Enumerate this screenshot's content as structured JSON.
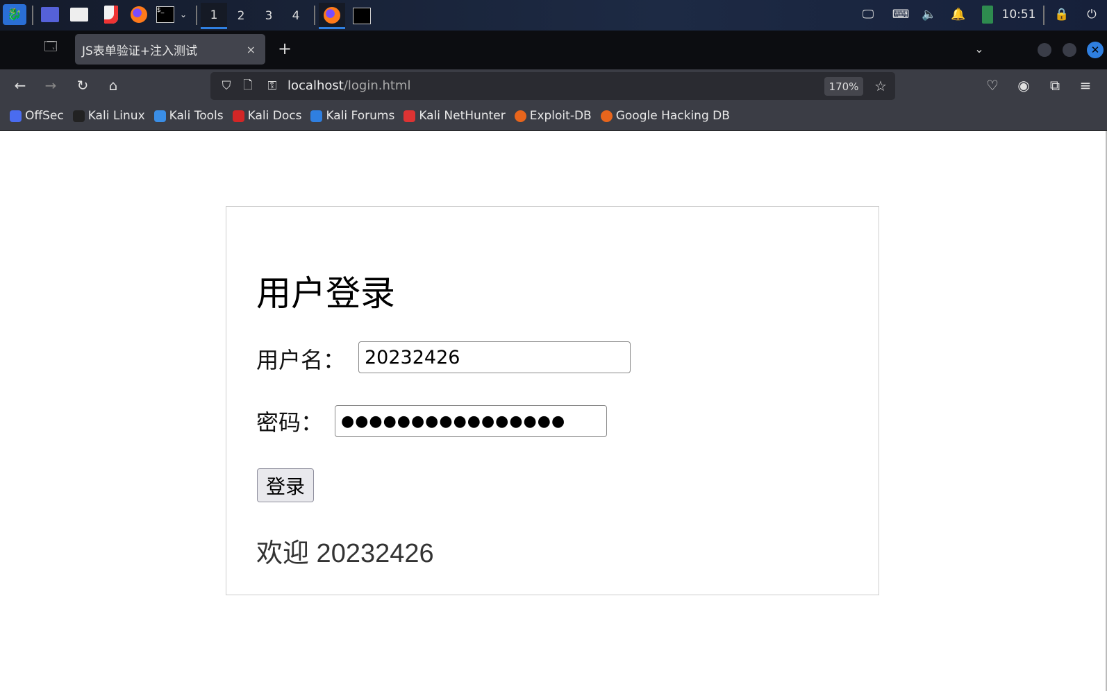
{
  "taskbar": {
    "workspaces": [
      "1",
      "2",
      "3",
      "4"
    ],
    "active_workspace": "1",
    "clock": "10:51"
  },
  "browser": {
    "tab_title": "JS表单验证+注入测试",
    "tab_close": "×",
    "new_tab": "+",
    "url_host": "localhost",
    "url_path": "/login.html",
    "zoom_level": "170%",
    "bookmarks": [
      {
        "label": "OffSec",
        "color": "#4a6cf0"
      },
      {
        "label": "Kali Linux",
        "color": "#222"
      },
      {
        "label": "Kali Tools",
        "color": "#3a8ee6"
      },
      {
        "label": "Kali Docs",
        "color": "#d32626"
      },
      {
        "label": "Kali Forums",
        "color": "#2f7fe0"
      },
      {
        "label": "Kali NetHunter",
        "color": "#d33"
      },
      {
        "label": "Exploit-DB",
        "color": "#e8651c"
      },
      {
        "label": "Google Hacking DB",
        "color": "#e8651c"
      }
    ]
  },
  "page": {
    "title": "用户登录",
    "username_label": "用户名：",
    "username_value": "20232426",
    "password_label": "密码：",
    "password_value": "●●●●●●●●●●●●●●●●",
    "login_button": "登录",
    "welcome": "欢迎 20232426"
  }
}
